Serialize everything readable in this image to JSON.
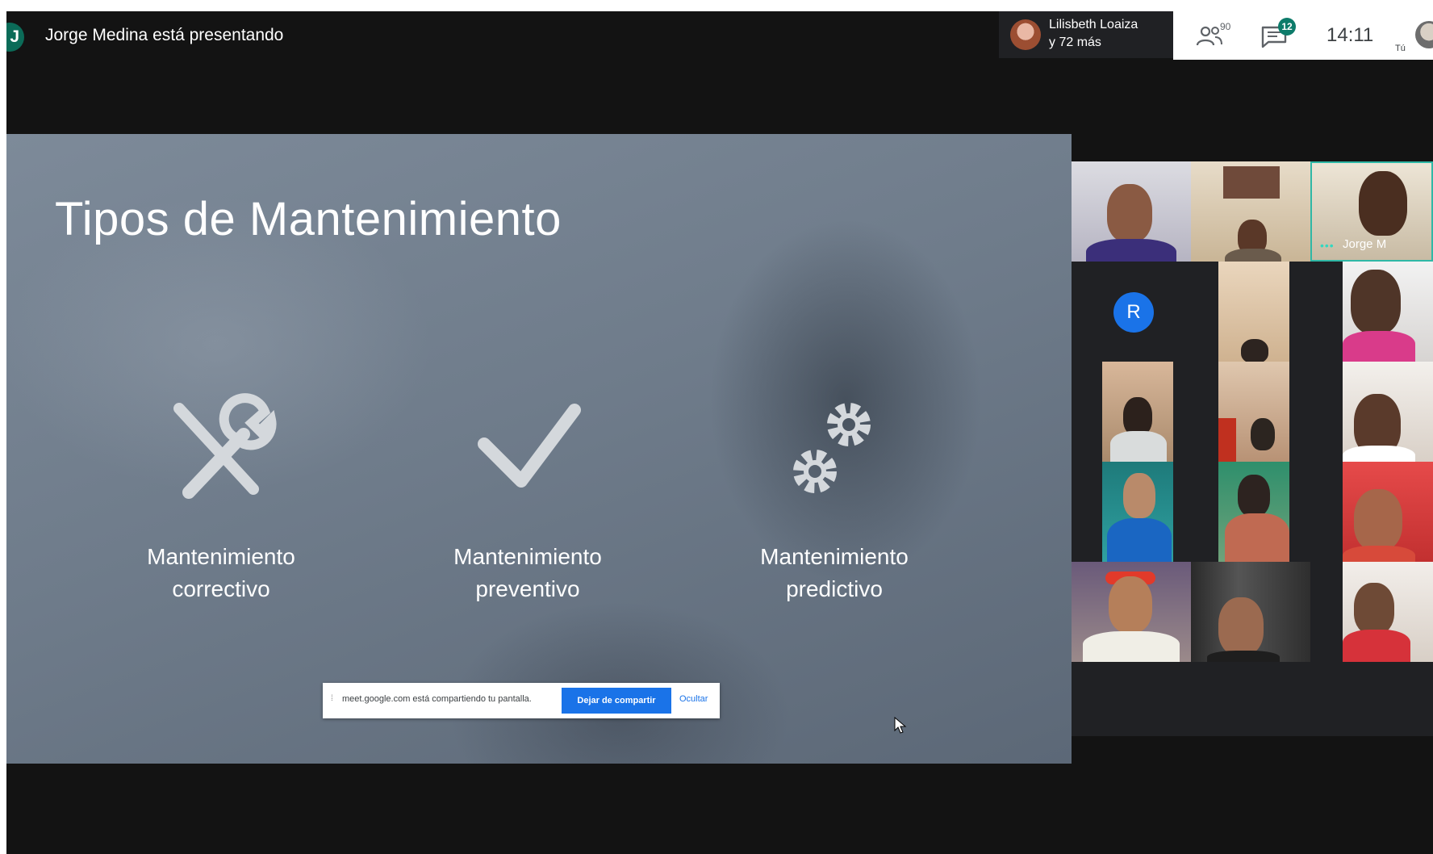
{
  "top_bar": {
    "presenter_initial": "J",
    "presenter_text": "Jorge Medina está presentando",
    "participants_name": "Lilisbeth Loaiza",
    "participants_more": "y 72 más",
    "people_count": "90",
    "chat_badge": "12",
    "clock": "14:11",
    "you_label": "Tú"
  },
  "slide": {
    "title": "Tipos de Mantenimiento",
    "categories": [
      {
        "line1": "Mantenimiento",
        "line2": "correctivo",
        "icon": "wrench-screwdriver-icon"
      },
      {
        "line1": "Mantenimiento",
        "line2": "preventivo",
        "icon": "checkmark-icon"
      },
      {
        "line1": "Mantenimiento",
        "line2": "predictivo",
        "icon": "gears-icon"
      }
    ]
  },
  "share_bar": {
    "message": "meet.google.com está compartiendo tu pantalla.",
    "stop_label": "Dejar de compartir",
    "hide_label": "Ocultar"
  },
  "grid": {
    "avatar_initial": "R",
    "tile_label": "Jorge M"
  },
  "colors": {
    "stage_bg": "#131313",
    "accent_blue": "#1a73e8",
    "teal": "#0d7b6a"
  }
}
